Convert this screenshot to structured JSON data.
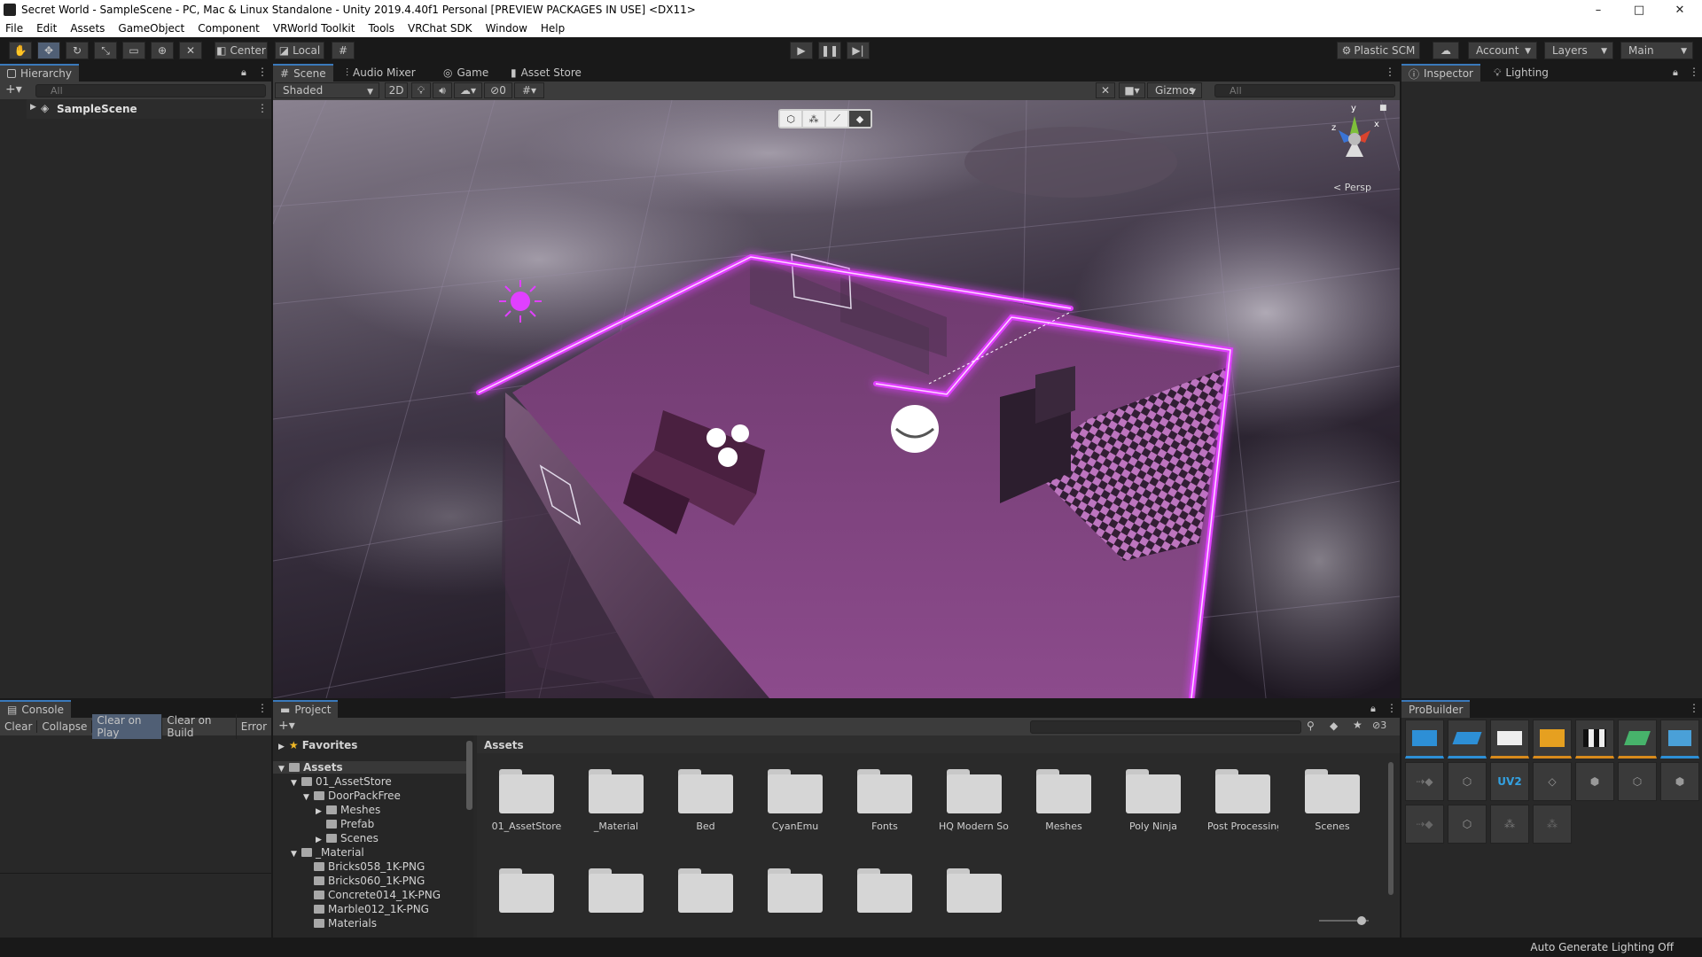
{
  "window": {
    "title": "Secret World - SampleScene - PC, Mac & Linux Standalone - Unity 2019.4.40f1 Personal [PREVIEW PACKAGES IN USE] <DX11>",
    "minimize": "–",
    "maximize": "□",
    "close": "✕"
  },
  "menu": [
    "File",
    "Edit",
    "Assets",
    "GameObject",
    "Component",
    "VRWorld Toolkit",
    "Tools",
    "VRChat SDK",
    "Window",
    "Help"
  ],
  "toolbar": {
    "center_label": "Center",
    "local_label": "Local",
    "plastic_label": "Plastic SCM",
    "account_label": "Account",
    "layers_label": "Layers",
    "layout_label": "Main"
  },
  "hierarchy": {
    "tab": "Hierarchy",
    "search_placeholder": "All",
    "scene_name": "SampleScene"
  },
  "scene_tabs": [
    "Scene",
    "Audio Mixer",
    "Game",
    "Asset Store"
  ],
  "scene_toolbar": {
    "shading": "Shaded",
    "mode_2d": "2D",
    "hidden_count": "0",
    "gizmos": "Gizmos",
    "search_placeholder": "All",
    "persp_label": "< Persp",
    "axis_y": "y",
    "axis_x": "x",
    "axis_z": "z"
  },
  "inspector_tabs": [
    "Inspector",
    "Lighting"
  ],
  "console": {
    "tab": "Console",
    "buttons": [
      "Clear",
      "Collapse",
      "Clear on Play",
      "Clear on Build",
      "Error"
    ]
  },
  "project": {
    "tab": "Project",
    "favorites": "Favorites",
    "badge": "3",
    "breadcrumb": "Assets",
    "tree": [
      {
        "label": "Assets",
        "depth": 0,
        "arrow": "▼"
      },
      {
        "label": "01_AssetStore",
        "depth": 1,
        "arrow": "▼"
      },
      {
        "label": "DoorPackFree",
        "depth": 2,
        "arrow": "▼"
      },
      {
        "label": "Meshes",
        "depth": 3,
        "arrow": "▶"
      },
      {
        "label": "Prefab",
        "depth": 3,
        "arrow": ""
      },
      {
        "label": "Scenes",
        "depth": 3,
        "arrow": "▶"
      },
      {
        "label": "_Material",
        "depth": 1,
        "arrow": "▼"
      },
      {
        "label": "Bricks058_1K-PNG",
        "depth": 2,
        "arrow": ""
      },
      {
        "label": "Bricks060_1K-PNG",
        "depth": 2,
        "arrow": ""
      },
      {
        "label": "Concrete014_1K-PNG",
        "depth": 2,
        "arrow": ""
      },
      {
        "label": "Marble012_1K-PNG",
        "depth": 2,
        "arrow": ""
      },
      {
        "label": "Materials",
        "depth": 2,
        "arrow": ""
      }
    ],
    "folders": [
      "01_AssetStore",
      "_Material",
      "Bed",
      "CyanEmu",
      "Fonts",
      "HQ Modern So...",
      "Meshes",
      "Poly Ninja",
      "Post Processing",
      "Scenes"
    ],
    "folders_row2_count": 6
  },
  "probuilder": {
    "tab": "ProBuilder"
  },
  "status": {
    "lighting": "Auto Generate Lighting Off"
  },
  "colors": {
    "accent": "#3a79bb",
    "neon": "#e040ff",
    "panel": "#282828",
    "header": "#3c3c3c"
  }
}
